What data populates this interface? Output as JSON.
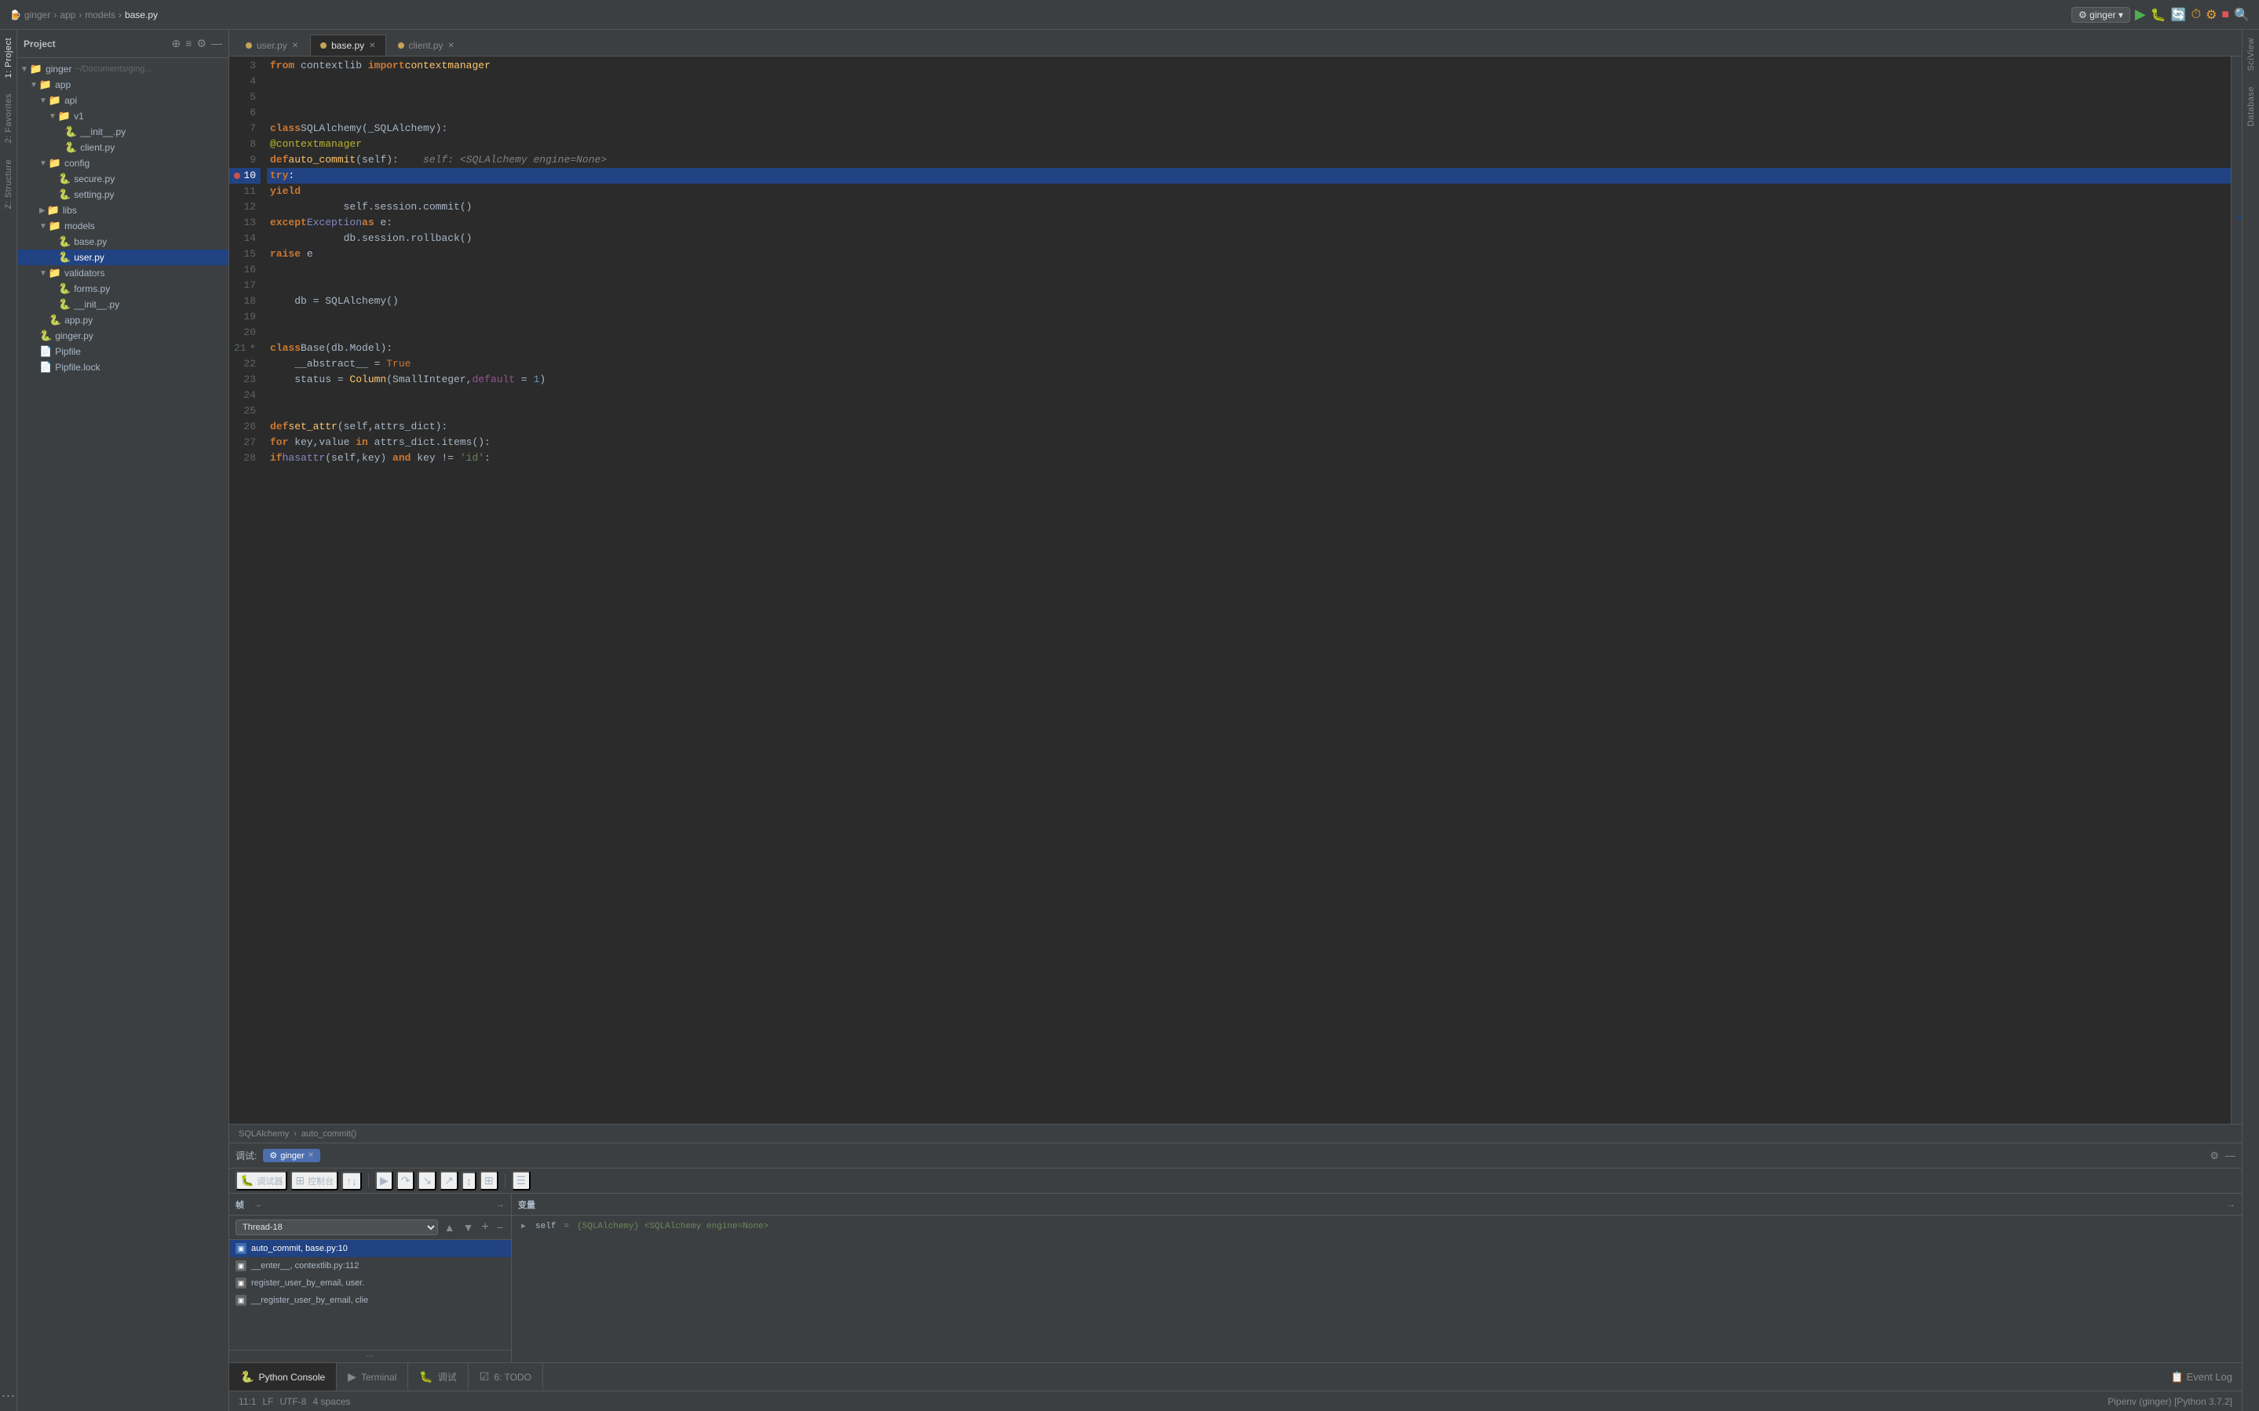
{
  "titlebar": {
    "breadcrumb": [
      "ginger",
      "app",
      "models",
      "base.py"
    ],
    "config_label": "ginger",
    "run_icon": "▶",
    "debug_icon": "🐛",
    "step_icon": "⏭",
    "stop_icon": "■",
    "search_icon": "🔍"
  },
  "project": {
    "title": "Project",
    "root": "ginger",
    "root_path": "~/Documents/ging...",
    "items": [
      {
        "level": 0,
        "type": "folder",
        "name": "ginger",
        "path": "~/Documents/ging...",
        "expanded": true
      },
      {
        "level": 1,
        "type": "folder",
        "name": "app",
        "expanded": true
      },
      {
        "level": 2,
        "type": "folder",
        "name": "api",
        "expanded": true
      },
      {
        "level": 3,
        "type": "folder",
        "name": "v1",
        "expanded": true
      },
      {
        "level": 4,
        "type": "file",
        "name": "__init__.py"
      },
      {
        "level": 4,
        "type": "file",
        "name": "client.py"
      },
      {
        "level": 2,
        "type": "folder",
        "name": "config",
        "expanded": true
      },
      {
        "level": 3,
        "type": "file",
        "name": "secure.py"
      },
      {
        "level": 3,
        "type": "file",
        "name": "setting.py"
      },
      {
        "level": 2,
        "type": "folder",
        "name": "libs",
        "expanded": false
      },
      {
        "level": 2,
        "type": "folder",
        "name": "models",
        "expanded": true
      },
      {
        "level": 3,
        "type": "file",
        "name": "base.py"
      },
      {
        "level": 3,
        "type": "file",
        "name": "user.py",
        "selected": true
      },
      {
        "level": 2,
        "type": "folder",
        "name": "validators",
        "expanded": true
      },
      {
        "level": 3,
        "type": "file",
        "name": "forms.py"
      },
      {
        "level": 3,
        "type": "file",
        "name": "__init__.py"
      },
      {
        "level": 2,
        "type": "file",
        "name": "app.py"
      },
      {
        "level": 1,
        "type": "file",
        "name": "ginger.py"
      },
      {
        "level": 1,
        "type": "file",
        "name": "Pipfile"
      },
      {
        "level": 1,
        "type": "file",
        "name": "Pipfile.lock"
      }
    ]
  },
  "tabs": [
    {
      "id": "user.py",
      "label": "user.py",
      "icon": "yellow"
    },
    {
      "id": "base.py",
      "label": "base.py",
      "icon": "yellow",
      "active": true
    },
    {
      "id": "client.py",
      "label": "client.py",
      "icon": "yellow"
    }
  ],
  "code": {
    "lines": [
      {
        "num": 3,
        "content": "from contextlib import contextmanager",
        "html": "<span class='kw'>from</span> contextlib <span class='kw'>import</span> <span class='fn'>contextmanager</span>"
      },
      {
        "num": 4,
        "content": "",
        "html": ""
      },
      {
        "num": 5,
        "content": "",
        "html": ""
      },
      {
        "num": 6,
        "content": "",
        "html": ""
      },
      {
        "num": 7,
        "content": "class SQLAlchemy(_SQLAlchemy):",
        "html": "<span class='kw'>class</span> <span class='cls'>SQLAlchemy</span>(_SQLAlchemy):"
      },
      {
        "num": 8,
        "content": "    @contextmanager",
        "html": "    <span class='decorator'>@contextmanager</span>"
      },
      {
        "num": 9,
        "content": "    def auto_commit(self):    self: <SQLAlchemy engine=None>",
        "html": "    <span class='kw'>def</span> <span class='fn'>auto_commit</span>(self):    <span class='comment'>self: &lt;SQLAlchemy engine=None&gt;</span>"
      },
      {
        "num": 10,
        "content": "        try:",
        "html": "        <span class='kw'>try</span>:",
        "highlighted": true
      },
      {
        "num": 11,
        "content": "            yield",
        "html": "            <span class='kw'>yield</span>"
      },
      {
        "num": 12,
        "content": "            self.session.commit()",
        "html": "            self.session.commit()"
      },
      {
        "num": 13,
        "content": "        except Exception as e:",
        "html": "        <span class='kw'>except</span> <span class='builtin'>Exception</span> <span class='kw'>as</span> e:"
      },
      {
        "num": 14,
        "content": "            db.session.rollback()",
        "html": "            db.session.rollback()"
      },
      {
        "num": 15,
        "content": "            raise e",
        "html": "            <span class='kw'>raise</span> e"
      },
      {
        "num": 16,
        "content": "",
        "html": ""
      },
      {
        "num": 17,
        "content": "",
        "html": ""
      },
      {
        "num": 18,
        "content": "    db = SQLAlchemy()",
        "html": "    db = <span class='cls'>SQLAlchemy</span>()"
      },
      {
        "num": 19,
        "content": "",
        "html": ""
      },
      {
        "num": 20,
        "content": "",
        "html": ""
      },
      {
        "num": 21,
        "content": "class Base(db.Model):",
        "html": "<span class='kw'>class</span> <span class='cls'>Base</span>(db.Model):"
      },
      {
        "num": 22,
        "content": "    __abstract__ = True",
        "html": "    __abstract__ = <span class='kw2'>True</span>"
      },
      {
        "num": 23,
        "content": "    status = Column(SmallInteger,default = 1)",
        "html": "    status = <span class='fn'>Column</span>(<span class='cls'>SmallInteger</span>,<span class='param'>default</span> = <span class='num'>1</span>)"
      },
      {
        "num": 24,
        "content": "",
        "html": ""
      },
      {
        "num": 25,
        "content": "",
        "html": ""
      },
      {
        "num": 26,
        "content": "    def set_attr(self,attrs_dict):",
        "html": "    <span class='kw'>def</span> <span class='fn'>set_attr</span>(self,attrs_dict):"
      },
      {
        "num": 27,
        "content": "        for key,value in attrs_dict.items():",
        "html": "        <span class='kw'>for</span> key,value <span class='kw'>in</span> attrs_dict.items():"
      },
      {
        "num": 28,
        "content": "            if hasattr(self,key) and key != 'id':",
        "html": "            <span class='kw'>if</span> <span class='builtin'>hasattr</span>(self,key) <span class='kw'>and</span> key != <span class='str'>'id'</span>:"
      }
    ]
  },
  "breadcrumb_bar": {
    "items": [
      "SQLAlchemy",
      "auto_commit()"
    ]
  },
  "debug": {
    "header_label": "调试:",
    "tab_label": "ginger",
    "toolbar_items": [
      "调试器",
      "控制台",
      "↑↓",
      "≡",
      "▲",
      "▼",
      "↕",
      "⤓",
      "↑",
      "↕2",
      "⊞"
    ],
    "frames_header": "帧",
    "variables_header": "变量",
    "thread_label": "Thread-18",
    "frames": [
      {
        "label": "auto_commit, base.py:10",
        "selected": true
      },
      {
        "label": "__enter__, contextlib.py:112",
        "selected": false
      },
      {
        "label": "register_user_by_email, user.",
        "selected": false
      },
      {
        "label": "__register_user_by_email, clie",
        "selected": false
      }
    ],
    "variables": [
      {
        "name": "self",
        "value": "= {SQLAlchemy} <SQLAlchemy engine=None>",
        "expandable": true
      }
    ]
  },
  "bottom_tabs": [
    {
      "id": "python-console",
      "label": "Python Console",
      "icon": "🐍",
      "active": true
    },
    {
      "id": "terminal",
      "label": "Terminal",
      "icon": "▶"
    },
    {
      "id": "debug",
      "label": "调试",
      "icon": "🐛"
    },
    {
      "id": "todo",
      "label": "6: TODO",
      "icon": "☑"
    }
  ],
  "status_bar": {
    "position": "11:1",
    "line_ending": "LF",
    "encoding": "UTF-8",
    "indent": "4 spaces",
    "env": "Pipenv (ginger) [Python 3.7.2]",
    "event_log": "Event Log"
  },
  "right_panel": {
    "items": [
      "SciView",
      "Database"
    ]
  }
}
